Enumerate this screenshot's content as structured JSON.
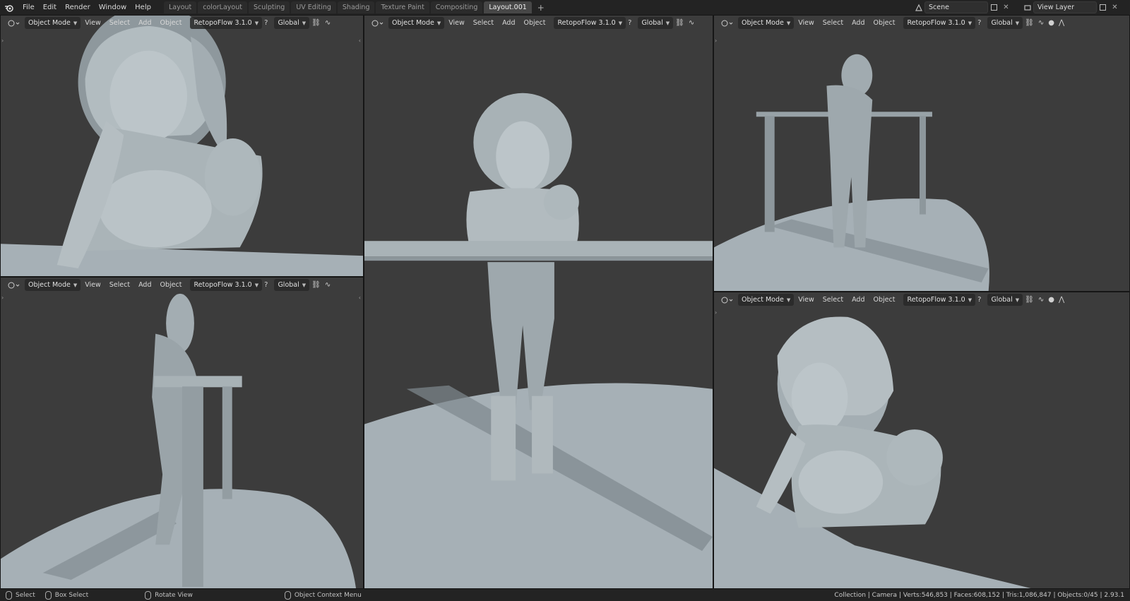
{
  "topbar": {
    "menus": [
      "File",
      "Edit",
      "Render",
      "Window",
      "Help"
    ],
    "tabs": [
      {
        "label": "Layout",
        "active": false
      },
      {
        "label": "colorLayout",
        "active": false
      },
      {
        "label": "Sculpting",
        "active": false
      },
      {
        "label": "UV Editing",
        "active": false
      },
      {
        "label": "Shading",
        "active": false
      },
      {
        "label": "Texture Paint",
        "active": false
      },
      {
        "label": "Compositing",
        "active": false
      },
      {
        "label": "Layout.001",
        "active": true
      }
    ],
    "add_tab": "+",
    "scene": "Scene",
    "view_layer": "View Layer"
  },
  "viewport_header": {
    "mode": "Object Mode",
    "view": "View",
    "select": "Select",
    "add": "Add",
    "object": "Object",
    "addon": "RetopoFlow 3.1.0",
    "help": "?",
    "orientation": "Global"
  },
  "statusbar": {
    "select": "Select",
    "box_select": "Box Select",
    "rotate_view": "Rotate View",
    "context_menu": "Object Context Menu",
    "stats": "Collection | Camera | Verts:546,853 | Faces:608,152 | Tris:1,086,847 | Objects:0/45 | 2.93.1"
  },
  "colors": {
    "viewport_bg": "#3c3c3c",
    "mesh": "#a9b3b8",
    "floor": "#a6b0b6",
    "active_tab": "#474747"
  }
}
